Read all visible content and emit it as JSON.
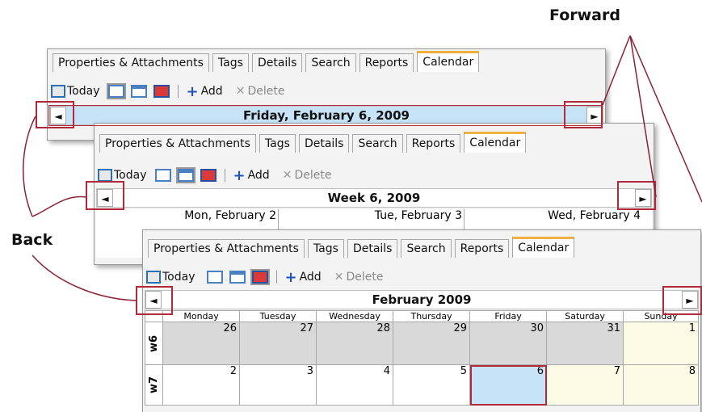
{
  "tabs": [
    "Properties & Attachments",
    "Tags",
    "Details",
    "Search",
    "Reports",
    "Calendar"
  ],
  "toolbar": {
    "today": "Today",
    "add": "Add",
    "delete": "Delete"
  },
  "panels": {
    "day": {
      "title": "Friday, February 6, 2009"
    },
    "week": {
      "title": "Week 6, 2009",
      "days": [
        "Mon, February 2",
        "Tue, February 3",
        "Wed, February 4"
      ]
    },
    "month": {
      "title": "February 2009",
      "weekdays": [
        "Monday",
        "Tuesday",
        "Wednesday",
        "Thursday",
        "Friday",
        "Saturday",
        "Sunday"
      ],
      "weeks": [
        {
          "label": "w6",
          "days": [
            "26",
            "27",
            "28",
            "29",
            "30",
            "31",
            "1"
          ]
        },
        {
          "label": "w7",
          "days": [
            "2",
            "3",
            "4",
            "5",
            "6",
            "7",
            "8"
          ]
        }
      ]
    }
  },
  "callouts": {
    "forward": "Forward",
    "back": "Back"
  },
  "nav": {
    "back_glyph": "◄",
    "forward_glyph": "►"
  },
  "colors": {
    "annotation_red": "#b2293a",
    "active_tab_accent": "#f0b040",
    "selected_day": "#c6e3f7",
    "weekend": "#fbfbe6",
    "prev_month": "#d9d9d9"
  }
}
